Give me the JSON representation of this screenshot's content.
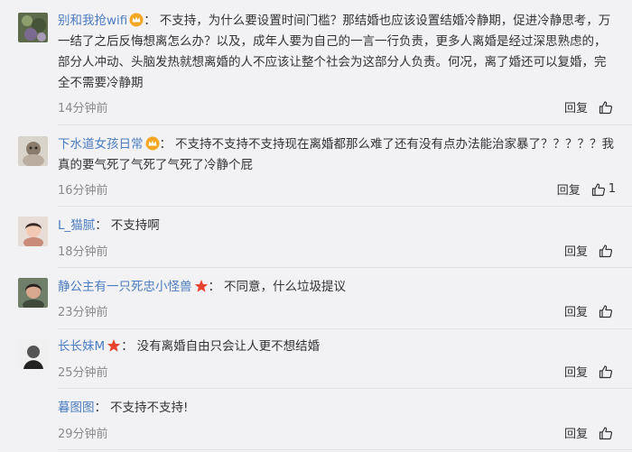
{
  "comments": [
    {
      "username": "别和我抢wifi",
      "badge": "crown-icon",
      "separator": "：",
      "text": "不支持，为什么要设置时间门槛？那结婚也应该设置结婚冷静期，促进冷静思考，万一结了之后反悔想离怎么办？以及，成年人要为自己的一言一行负责，更多人离婚是经过深思熟虑的，部分人冲动、头脑发热就想离婚的人不应该让整个社会为这部分人负责。何况，离了婚还可以复婚，完全不需要冷静期",
      "time": "14分钟前",
      "reply_label": "回复",
      "likes": ""
    },
    {
      "username": "下水道女孩日常",
      "badge": "crown-icon",
      "separator": "：",
      "text": "不支持不支持不支持现在离婚都那么难了还有没有点办法能治家暴了？？？？？我真的要气死了气死了气死了冷静个屁",
      "time": "16分钟前",
      "reply_label": "回复",
      "likes": "1"
    },
    {
      "username": "L_猫腻",
      "badge": "",
      "separator": "：",
      "text": "不支持啊",
      "time": "18分钟前",
      "reply_label": "回复",
      "likes": ""
    },
    {
      "username": "静公主有一只死忠小怪兽",
      "badge": "star-icon",
      "separator": "：",
      "text": "不同意，什么垃圾提议",
      "time": "23分钟前",
      "reply_label": "回复",
      "likes": ""
    },
    {
      "username": "长长妹M",
      "badge": "star-icon",
      "separator": "：",
      "text": "没有离婚自由只会让人更不想结婚",
      "time": "25分钟前",
      "reply_label": "回复",
      "likes": ""
    },
    {
      "username": "暮图图",
      "badge": "",
      "separator": "：",
      "text": "不支持不支持!",
      "time": "29分钟前",
      "reply_label": "回复",
      "likes": ""
    }
  ]
}
